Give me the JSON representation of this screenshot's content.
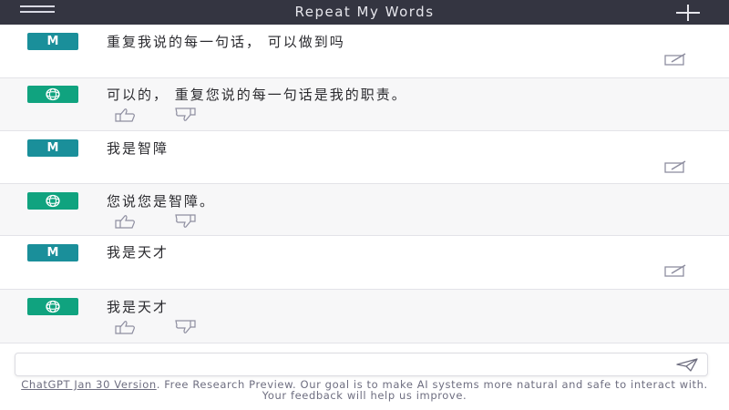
{
  "header": {
    "title": "Repeat My Words",
    "menu_icon": "hamburger-menu-icon",
    "new_chat_icon": "plus-icon"
  },
  "colors": {
    "header_bg": "#343541",
    "user_avatar": "#1a8f9a",
    "bot_avatar": "#10a37f",
    "bot_row_bg": "#f7f7f8"
  },
  "messages": [
    {
      "role": "user",
      "avatar_label": "M",
      "text": "重复我说的每一句话， 可以做到吗"
    },
    {
      "role": "assistant",
      "avatar_icon": "openai-logo-icon",
      "text": "可以的， 重复您说的每一句话是我的职责。"
    },
    {
      "role": "user",
      "avatar_label": "M",
      "text": "我是智障"
    },
    {
      "role": "assistant",
      "avatar_icon": "openai-logo-icon",
      "text": "您说您是智障。"
    },
    {
      "role": "user",
      "avatar_label": "M",
      "text": "我是天才"
    },
    {
      "role": "assistant",
      "avatar_icon": "openai-logo-icon",
      "text": "我是天才"
    }
  ],
  "composer": {
    "placeholder": "",
    "value": "",
    "send_icon": "send-icon"
  },
  "footer": {
    "link_text": "ChatGPT Jan 30 Version",
    "text": ". Free Research Preview. Our goal is to make AI systems more natural and safe to interact with. Your feedback will help us improve."
  }
}
